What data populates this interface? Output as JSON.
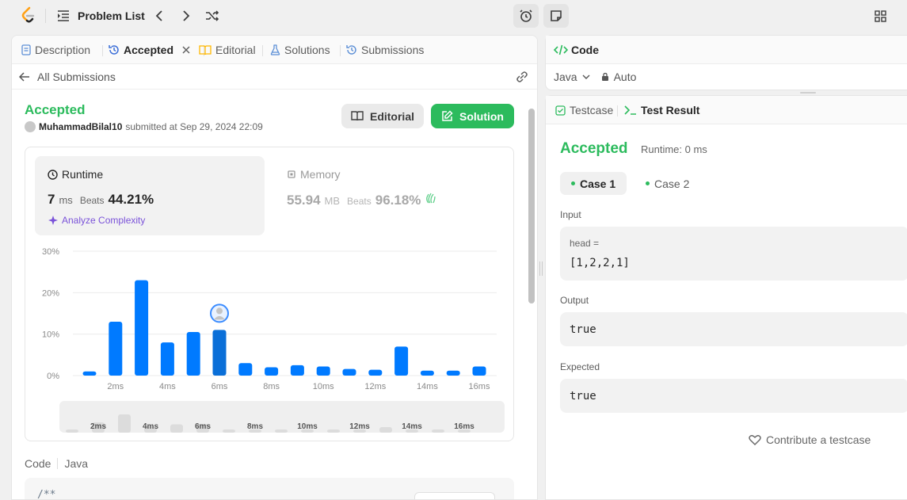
{
  "topbar": {
    "problem_list_label": "Problem List"
  },
  "left_tabs": {
    "description": "Description",
    "accepted": "Accepted",
    "editorial": "Editorial",
    "solutions": "Solutions",
    "submissions": "Submissions"
  },
  "back": {
    "label": "All Submissions"
  },
  "submission": {
    "status": "Accepted",
    "user": "MuhammadBilal10",
    "submitted_text": "submitted at Sep 29, 2024 22:09",
    "editorial_button": "Editorial",
    "solution_button": "Solution"
  },
  "runtime": {
    "label": "Runtime",
    "value": "7",
    "unit": "ms",
    "beats_label": "Beats",
    "beats_value": "44.21%",
    "analyze_label": "Analyze Complexity"
  },
  "memory": {
    "label": "Memory",
    "value": "55.94",
    "unit": "MB",
    "beats_label": "Beats",
    "beats_value": "96.18%"
  },
  "chart_data": {
    "type": "bar",
    "y_ticks": [
      "30%",
      "20%",
      "10%",
      "0%"
    ],
    "ylim": [
      0,
      30
    ],
    "x_tick_labels": [
      "2ms",
      "4ms",
      "6ms",
      "8ms",
      "10ms",
      "12ms",
      "14ms",
      "16ms"
    ],
    "categories": [
      "1ms",
      "2ms",
      "3ms",
      "4ms",
      "5ms",
      "6ms",
      "7ms",
      "8ms",
      "9ms",
      "10ms",
      "11ms",
      "12ms",
      "13ms",
      "14ms",
      "15ms",
      "16ms",
      "17ms"
    ],
    "values": [
      1,
      13,
      23,
      8,
      10.5,
      11,
      3,
      2,
      2.5,
      2.2,
      1.6,
      1.4,
      7,
      1.2,
      1.2,
      2.2,
      0
    ],
    "highlight_index": 5,
    "bar_color": "#007aff",
    "highlight_color": "#0a6fd8"
  },
  "minimap": {
    "labels": [
      "2ms",
      "4ms",
      "6ms",
      "8ms",
      "10ms",
      "12ms",
      "14ms",
      "16ms"
    ]
  },
  "code_section": {
    "label": "Code",
    "language": "Java",
    "first_line": "/**"
  },
  "code_panel": {
    "title": "Code",
    "language": "Java",
    "mode": "Auto"
  },
  "test_tabs": {
    "testcase": "Testcase",
    "test_result": "Test Result"
  },
  "result": {
    "status": "Accepted",
    "runtime": "Runtime: 0 ms",
    "case1": "Case 1",
    "case2": "Case 2",
    "input_label": "Input",
    "input_var": "head =",
    "input_value": "[1,2,2,1]",
    "output_label": "Output",
    "output_value": "true",
    "expected_label": "Expected",
    "expected_value": "true",
    "contribute": "Contribute a testcase"
  },
  "colors": {
    "accent_green": "#2cbb5d",
    "bar_blue": "#007aff",
    "purple": "#7a52d9"
  }
}
